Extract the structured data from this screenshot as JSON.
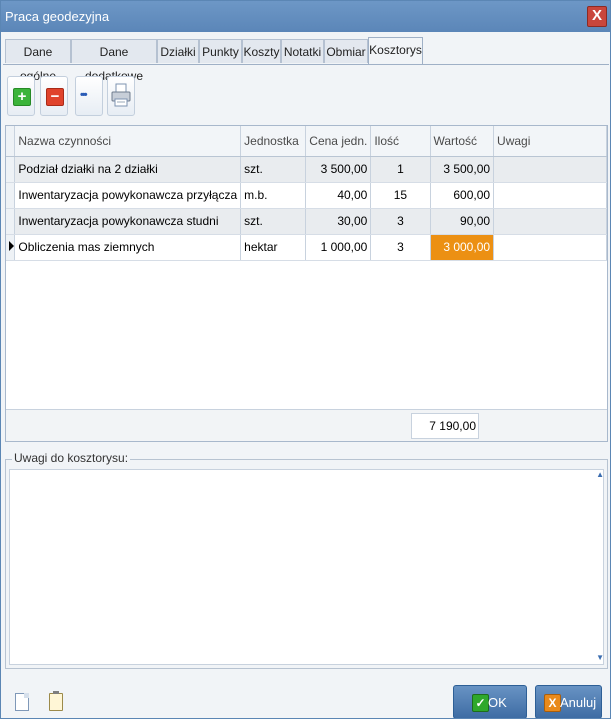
{
  "window": {
    "title": "Praca geodezyjna",
    "close_label": "X"
  },
  "tabs": [
    {
      "label": "Dane ogólne"
    },
    {
      "label": "Dane dodatkowe"
    },
    {
      "label": "Działki"
    },
    {
      "label": "Punkty"
    },
    {
      "label": "Koszty"
    },
    {
      "label": "Notatki"
    },
    {
      "label": "Obmiar"
    },
    {
      "label": "Kosztorys",
      "active": true
    }
  ],
  "toolbar": {
    "add_symbol": "+",
    "remove_symbol": "−",
    "icons": [
      "add-icon",
      "remove-icon",
      "move-icon",
      "printer-icon"
    ]
  },
  "table": {
    "columns": [
      "Nazwa czynności",
      "Jednostka",
      "Cena jedn.",
      "Ilość",
      "Wartość",
      "Uwagi"
    ],
    "rows": [
      {
        "name": "Podział działki na 2 działki",
        "unit": "szt.",
        "price": "3 500,00",
        "qty": "1",
        "value": "3 500,00",
        "notes": ""
      },
      {
        "name": "Inwentaryzacja powykonawcza przyłącza",
        "unit": "m.b.",
        "price": "40,00",
        "qty": "15",
        "value": "600,00",
        "notes": ""
      },
      {
        "name": "Inwentaryzacja powykonawcza studni",
        "unit": "szt.",
        "price": "30,00",
        "qty": "3",
        "value": "90,00",
        "notes": ""
      },
      {
        "name": "Obliczenia mas ziemnych",
        "unit": "hektar",
        "price": "1 000,00",
        "qty": "3",
        "value": "3 000,00",
        "notes": "",
        "selected": true
      }
    ],
    "total": "7 190,00"
  },
  "notes": {
    "legend": "Uwagi do kosztorysu:",
    "value": ""
  },
  "buttons": {
    "ok": "OK",
    "cancel": "Anuluj",
    "ok_symbol": "✓",
    "cancel_symbol": "X"
  },
  "colors": {
    "titlebar": "#5b86b8",
    "selected_cell": "#ec9013",
    "ok_icon": "#2fa82b",
    "cancel_icon": "#e98a1c"
  }
}
